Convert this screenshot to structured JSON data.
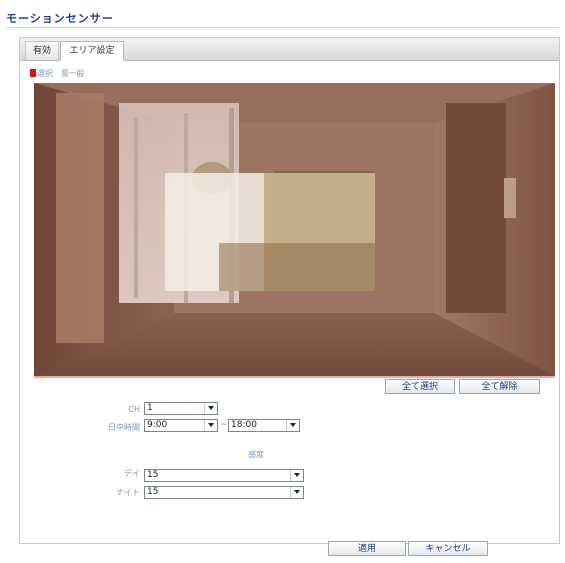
{
  "page": {
    "title": "モーションセンサー"
  },
  "tabs": [
    {
      "label": "有効"
    },
    {
      "label": "エリア設定"
    }
  ],
  "legend": {
    "selected_label": "選択",
    "normal_label": "一般",
    "selected_color": "#e01010",
    "normal_color": "#c8ccd6"
  },
  "area_buttons": {
    "select_all": "全て選択",
    "clear_all": "全て解除"
  },
  "form": {
    "ch_label": "CH",
    "ch_value": "1",
    "daytime_label": "日中時間",
    "daytime_start": "9:00",
    "daytime_separator": "~",
    "daytime_end": "18:00",
    "sensitivity_heading": "感度",
    "day_label": "デイ",
    "day_value": "15",
    "night_label": "ナイト",
    "night_value": "15"
  },
  "footer": {
    "apply": "適用",
    "cancel": "キャンセル"
  },
  "colors": {
    "title": "#1f3f8f",
    "button_text": "#233a74",
    "label_text": "#7f95c0"
  }
}
